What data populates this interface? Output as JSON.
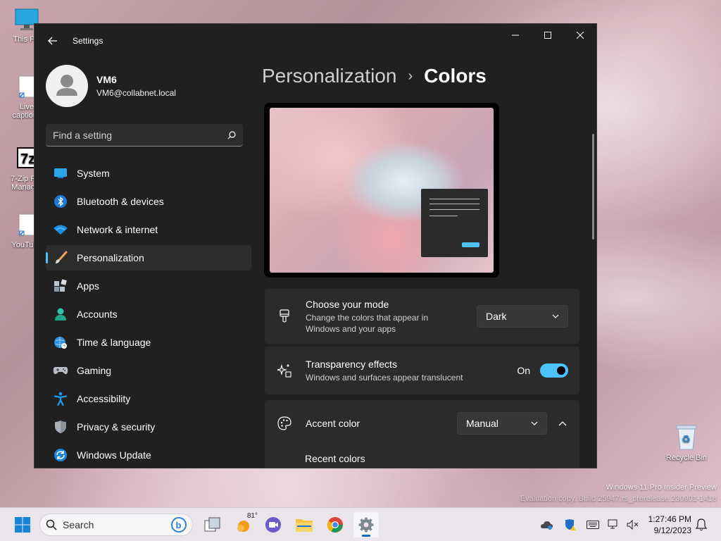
{
  "desktop": {
    "icons": [
      {
        "label": "This PC",
        "icon": "monitor-icon"
      },
      {
        "label": "Live captions",
        "icon": "shortcut-icon"
      },
      {
        "label": "7-Zip File Manager",
        "icon": "7zip-icon"
      },
      {
        "label": "YouTube",
        "icon": "shortcut-icon"
      }
    ],
    "recycle_bin": "Recycle Bin",
    "watermark_line1": "Windows 11 Pro Insider Preview",
    "watermark_line2": "Evaluation copy. Build 25947.rs_prerelease.230901-1416"
  },
  "window": {
    "title": "Settings",
    "profile": {
      "name": "VM6",
      "email": "VM6@collabnet.local"
    },
    "search_placeholder": "Find a setting",
    "nav": [
      {
        "label": "System",
        "icon": "system-icon"
      },
      {
        "label": "Bluetooth & devices",
        "icon": "bluetooth-icon"
      },
      {
        "label": "Network & internet",
        "icon": "wifi-icon"
      },
      {
        "label": "Personalization",
        "icon": "brush-icon",
        "active": true
      },
      {
        "label": "Apps",
        "icon": "apps-icon"
      },
      {
        "label": "Accounts",
        "icon": "accounts-icon"
      },
      {
        "label": "Time & language",
        "icon": "globe-clock-icon"
      },
      {
        "label": "Gaming",
        "icon": "gamepad-icon"
      },
      {
        "label": "Accessibility",
        "icon": "accessibility-icon"
      },
      {
        "label": "Privacy & security",
        "icon": "shield-icon"
      },
      {
        "label": "Windows Update",
        "icon": "update-icon"
      }
    ],
    "breadcrumb": {
      "parent": "Personalization",
      "separator": "›",
      "current": "Colors"
    },
    "mode": {
      "title": "Choose your mode",
      "description": "Change the colors that appear in Windows and your apps",
      "value": "Dark"
    },
    "transparency": {
      "title": "Transparency effects",
      "description": "Windows and surfaces appear translucent",
      "state_label": "On",
      "enabled": true
    },
    "accent": {
      "title": "Accent color",
      "value": "Manual",
      "recent_colors_label": "Recent colors"
    }
  },
  "taskbar": {
    "search_label": "Search",
    "weather_temp": "81°",
    "time": "1:27:46 PM",
    "date": "9/12/2023"
  },
  "colors": {
    "accent": "#4cc2ff",
    "window_bg": "#202020",
    "card_bg": "#2b2b2b"
  }
}
